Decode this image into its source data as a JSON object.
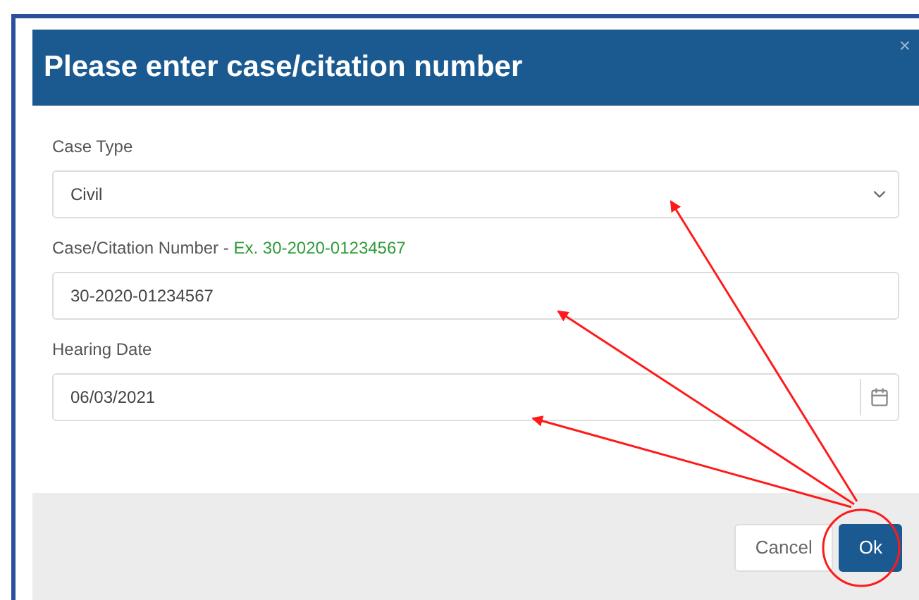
{
  "dialog": {
    "title": "Please enter case/citation number",
    "close": "×"
  },
  "fields": [
    {
      "kind": "select",
      "label": "Case Type",
      "value": "Civil"
    },
    {
      "kind": "text",
      "label": "Case/Citation Number - ",
      "hint": "Ex. 30-2020-01234567",
      "value": "30-2020-01234567"
    },
    {
      "kind": "date",
      "label": "Hearing Date",
      "value": "06/03/2021"
    }
  ],
  "buttons": [
    {
      "label": "Cancel",
      "primary": false
    },
    {
      "label": "Ok",
      "primary": true
    }
  ]
}
